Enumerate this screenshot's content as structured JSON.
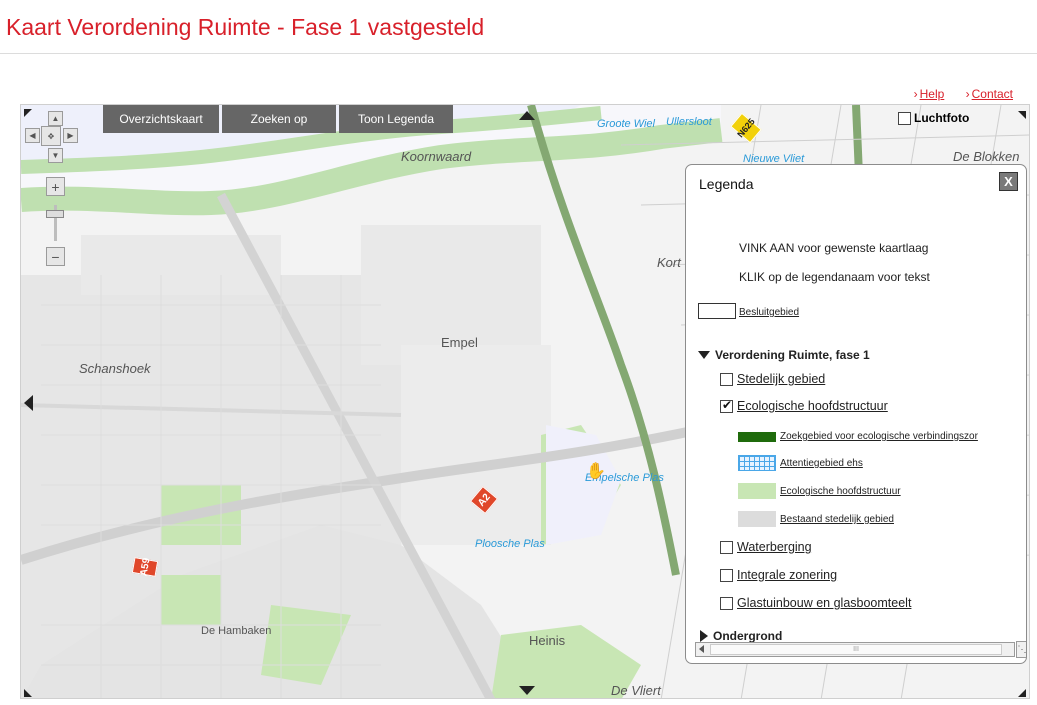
{
  "page": {
    "title": "Kaart Verordening Ruimte - Fase 1 vastgesteld"
  },
  "toplinks": {
    "help": "Help",
    "contact": "Contact"
  },
  "tabs": [
    "Overzichtskaart",
    "Zoeken op",
    "Toon Legenda"
  ],
  "luchtfoto": {
    "label": "Luchtfoto",
    "checked": false
  },
  "map_labels": {
    "koornwaard": "Koornwaard",
    "schanshoek": "Schanshoek",
    "empel": "Empel",
    "de_hambaken": "De Hambaken",
    "heinis": "Heinis",
    "de_vliert": "De Vliert",
    "de_blokken": "De Blokken",
    "kort": "Kort",
    "groote_wiel": "Groote Wiel",
    "ullersloot": "Ullersloot",
    "nieuwe_vliet": "Nieuwe Vliet",
    "empelsche_plas": "Empelsche Plas",
    "ploosche_plas": "Ploosche Plas"
  },
  "road_shields": {
    "n625": "N625",
    "a2": "A2",
    "a59": "A59"
  },
  "legend": {
    "title": "Legenda",
    "close": "X",
    "instructions": [
      "VINK AAN voor gewenste kaartlaag",
      "KLIK op de legendanaam voor tekst"
    ],
    "besluitgebied": "Besluitgebied",
    "group_1": {
      "title": "Verordening Ruimte, fase 1",
      "items": [
        {
          "label": "Stedelijk gebied",
          "checked": false
        },
        {
          "label": "Ecologische hoofdstructuur",
          "checked": true
        },
        {
          "label": "Waterberging",
          "checked": false
        },
        {
          "label": "Integrale zonering",
          "checked": false
        },
        {
          "label": "Glastuinbouw en glasboomteelt",
          "checked": false
        }
      ],
      "sub_items": [
        {
          "label": "Zoekgebied voor ecologische verbindingszor",
          "color": "#1f6b0c"
        },
        {
          "label": "Attentiegebied ehs",
          "color": "#4aa7e8"
        },
        {
          "label": "Ecologische hoofdstructuur",
          "color": "#c8e6b4"
        },
        {
          "label": "Bestaand stedelijk gebied",
          "color": "#dcdcdc"
        }
      ]
    },
    "group_2": {
      "title": "Ondergrond"
    },
    "scroll_center": "III"
  },
  "colors": {
    "accent": "#d8202a",
    "tab_bg": "#666666"
  }
}
